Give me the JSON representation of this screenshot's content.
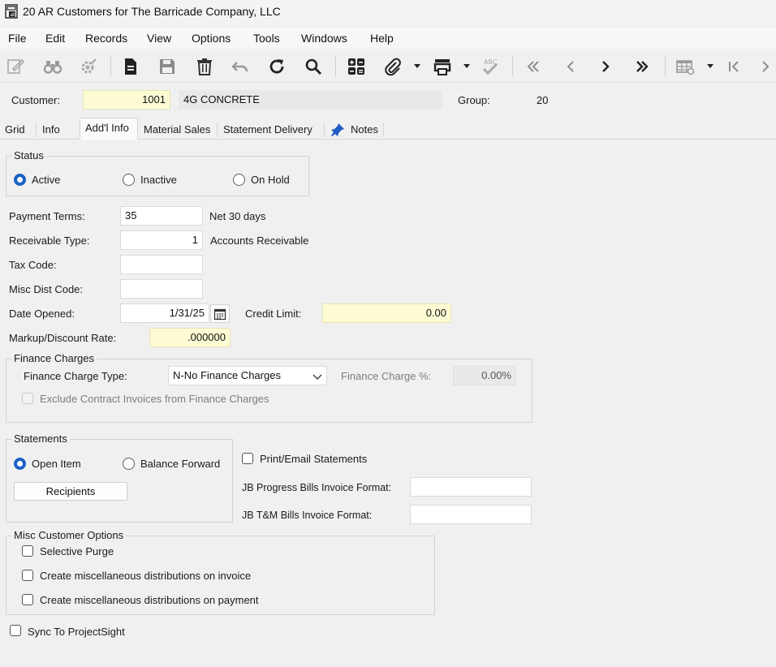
{
  "window": {
    "title": "20 AR Customers for The Barricade Company, LLC"
  },
  "menu": [
    "File",
    "Edit",
    "Records",
    "View",
    "Options",
    "Tools",
    "Windows",
    "Help"
  ],
  "header": {
    "customer_label": "Customer:",
    "customer_number": "1001",
    "customer_name": "4G CONCRETE",
    "group_label": "Group:",
    "group_value": "20"
  },
  "tabs": [
    "Grid",
    "Info",
    "Add'l Info",
    "Material Sales",
    "Statement Delivery",
    "Notes"
  ],
  "status": {
    "title": "Status",
    "options": [
      "Active",
      "Inactive",
      "On Hold"
    ],
    "selected": "Active"
  },
  "fields": {
    "payment_terms_label": "Payment Terms:",
    "payment_terms_value": "35",
    "payment_terms_desc": "Net 30 days",
    "receivable_type_label": "Receivable Type:",
    "receivable_type_value": "1",
    "receivable_type_desc": "Accounts Receivable",
    "tax_code_label": "Tax Code:",
    "tax_code_value": "",
    "misc_dist_label": "Misc Dist Code:",
    "misc_dist_value": "",
    "date_opened_label": "Date Opened:",
    "date_opened_value": "1/31/25",
    "credit_limit_label": "Credit Limit:",
    "credit_limit_value": "0.00",
    "markup_label": "Markup/Discount Rate:",
    "markup_value": ".000000"
  },
  "finance": {
    "title": "Finance Charges",
    "type_label": "Finance Charge Type:",
    "type_value": "N-No Finance Charges",
    "pct_label": "Finance Charge %:",
    "pct_value": "0.00%",
    "exclude_label": "Exclude Contract Invoices from Finance Charges"
  },
  "statements": {
    "title": "Statements",
    "options": [
      "Open Item",
      "Balance Forward"
    ],
    "selected": "Open Item",
    "recipients_label": "Recipients",
    "print_email_label": "Print/Email Statements",
    "jb_progress_label": "JB Progress Bills Invoice Format:",
    "jb_progress_value": "",
    "jb_tm_label": "JB T&M Bills Invoice Format:",
    "jb_tm_value": ""
  },
  "misc": {
    "title": "Misc Customer Options",
    "selective_purge": "Selective Purge",
    "create_on_invoice": "Create miscellaneous distributions on invoice",
    "create_on_payment": "Create miscellaneous distributions on payment"
  },
  "sync_label": "Sync To ProjectSight"
}
